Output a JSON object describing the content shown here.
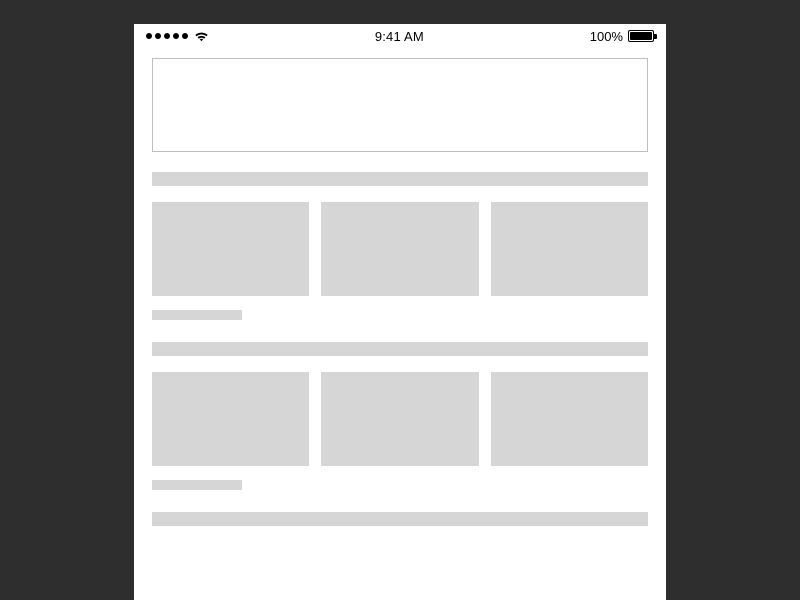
{
  "status_bar": {
    "time": "9:41 AM",
    "battery_percent": "100%"
  }
}
